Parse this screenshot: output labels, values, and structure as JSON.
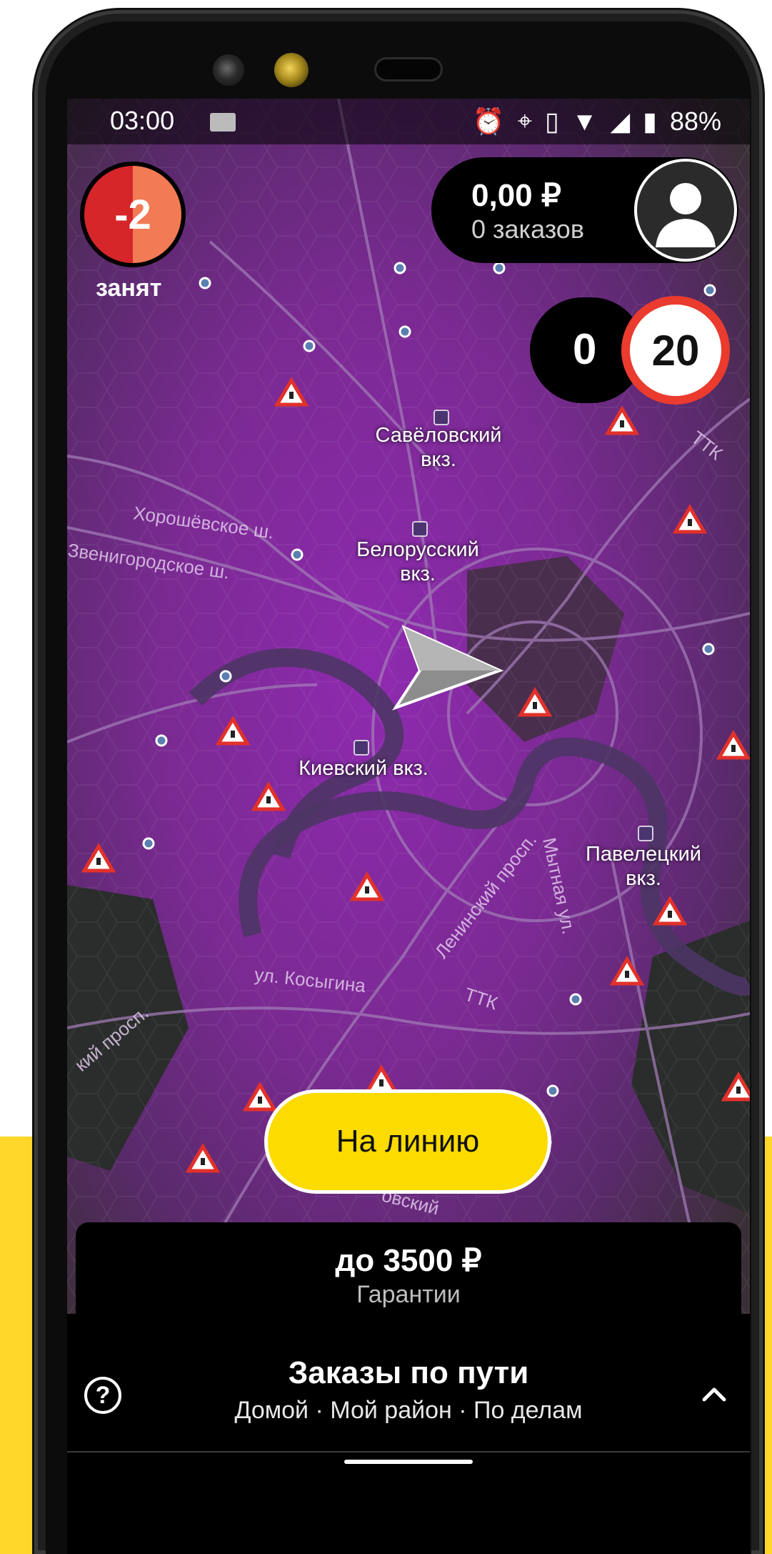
{
  "status_bar": {
    "time": "03:00",
    "battery": "88%"
  },
  "driver": {
    "priority": "-2",
    "state_label": "занят"
  },
  "earnings": {
    "amount": "0,00 ₽",
    "orders": "0 заказов"
  },
  "speed": {
    "current": "0",
    "limit": "20"
  },
  "map": {
    "places": [
      {
        "label": "Савёловский\nвкз."
      },
      {
        "label": "Белорусский\nвкз."
      },
      {
        "label": "Киевский вкз."
      },
      {
        "label": "Павелецкий\nвкз."
      }
    ],
    "roads": [
      {
        "label": "Хорошёвское ш."
      },
      {
        "label": "Звенигородское ш."
      },
      {
        "label": "ул. Косыгина"
      },
      {
        "label": "Ленинский просп."
      },
      {
        "label": "Мытная ул."
      },
      {
        "label": "ТТК"
      },
      {
        "label": "ТТК"
      },
      {
        "label": "кий просп."
      },
      {
        "label": "овский"
      }
    ],
    "colors": {
      "heat": "#7a2a92",
      "dark": "#2b2b2b",
      "road": "#a07ab5"
    }
  },
  "go_online": {
    "label": "На линию"
  },
  "guarantee": {
    "amount": "до 3500 ₽",
    "label": "Гарантии"
  },
  "orders_on_way": {
    "title": "Заказы по пути",
    "subtitle": "Домой · Мой район · По делам"
  },
  "colors": {
    "accent_yellow": "#fbdb00",
    "brand_yellow": "#ffd629",
    "speed_limit_red": "#ea3b2e",
    "priority_red": "#d6262a"
  }
}
